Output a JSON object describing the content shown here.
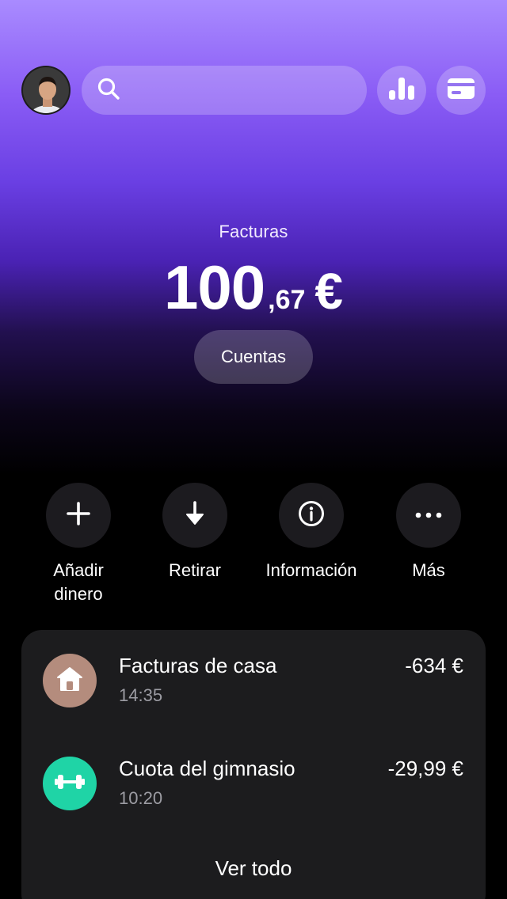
{
  "header": {
    "search": {
      "placeholder": ""
    },
    "icons": {
      "search": "search-icon",
      "stats": "bar-chart-icon",
      "card": "credit-card-icon",
      "avatar": "user-avatar"
    }
  },
  "balance": {
    "label": "Facturas",
    "integer": "100",
    "decimal": ",67",
    "currency": "€"
  },
  "accounts_button": {
    "label": "Cuentas"
  },
  "actions": [
    {
      "label_line1": "Añadir",
      "label_line2": "dinero",
      "icon": "plus-icon"
    },
    {
      "label_line1": "Retirar",
      "label_line2": "",
      "icon": "arrow-down-icon"
    },
    {
      "label_line1": "Información",
      "label_line2": "",
      "icon": "info-icon"
    },
    {
      "label_line1": "Más",
      "label_line2": "",
      "icon": "more-icon"
    }
  ],
  "transactions": [
    {
      "title": "Facturas de casa",
      "time": "14:35",
      "amount": "-634 €",
      "icon": "house-icon",
      "icon_color": "#b48c7d"
    },
    {
      "title": "Cuota del gimnasio",
      "time": "10:20",
      "amount": "-29,99 €",
      "icon": "dumbbell-icon",
      "icon_color": "#1fd4a6"
    }
  ],
  "see_all": "Ver todo",
  "colors": {
    "gradient_top": "#a98bff",
    "gradient_mid": "#6a3fe3",
    "background": "#000000",
    "panel": "#1c1c1e",
    "action_circle": "#1c1b1f"
  }
}
